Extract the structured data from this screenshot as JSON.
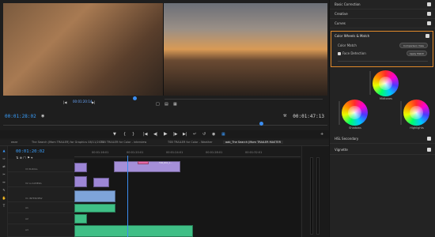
{
  "program_monitor": {
    "timecode_small": "00:01:20:14",
    "timecode_current": "00:01:28:02",
    "timecode_duration": "00:01:47:13"
  },
  "lumetri": {
    "sections": [
      "Basic Correction",
      "Creative",
      "Curves",
      "HSL Secondary",
      "Vignette"
    ],
    "color_wheels_match": {
      "title": "Color Wheels & Match",
      "color_match_label": "Color Match",
      "comparison_view_label": "Comparison View",
      "face_detection_label": "Face Detection",
      "apply_match_label": "Apply Match"
    },
    "wheels": {
      "midtones": "Midtones",
      "shadows": "Shadows",
      "highlights": "Highlights"
    }
  },
  "timeline": {
    "tabs": [
      "eeze",
      "The Search (Mom TRAILER) for Graphics 08/11/2022",
      "TSB TRAILER for Color - interview",
      "TSB TRAILER for Color - Weather",
      "aab_The Search (Mom TRAILER MASTER"
    ],
    "timecode": "00:01:20:02",
    "ruler_labels": [
      "00:01:16:01",
      "00:01:20:01",
      "00:01:24:01",
      "00:01:28:01",
      "00:01:32:01"
    ],
    "tracks": [
      "V3 B-ROLL",
      "V2 A-CAMERA",
      "V1 INTERVIEW",
      "A1",
      "A2",
      "A3"
    ],
    "clip_label": "TSM_B01_1..."
  },
  "colors": {
    "accent_blue": "#3aa0ff",
    "highlight_orange": "#e0892a",
    "video_clip": "#9d86d6",
    "video_clip_v1": "#7ea4d9",
    "audio_clip": "#3fbf86"
  }
}
